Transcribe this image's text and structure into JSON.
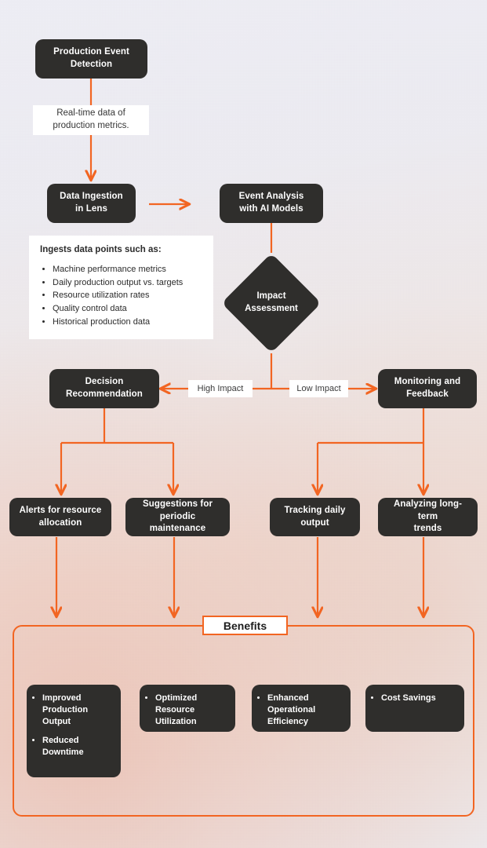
{
  "theme": {
    "node_bg": "#2f2e2c",
    "node_text": "#ffffff",
    "accent": "#f26522",
    "panel_bg": "#ffffff",
    "page_bg_top": "#eeeef5",
    "page_bg_bottom": "#f0e6e2"
  },
  "nodes": {
    "production_event_detection": "Production Event\nDetection",
    "data_ingestion": "Data Ingestion\nin Lens",
    "event_analysis": "Event Analysis\nwith AI Models",
    "impact_assessment": "Impact\nAssessment",
    "decision_recommendation": "Decision\nRecommendation",
    "monitoring_feedback": "Monitoring and\nFeedback",
    "alerts_resource": "Alerts for resource\nallocation",
    "suggestions_maintenance": "Suggestions for\nperiodic maintenance",
    "tracking_output": "Tracking daily\noutput",
    "analyzing_trends": "Analyzing long-term\ntrends"
  },
  "edge_labels": {
    "realtime_data": "Real-time data of\nproduction metrics.",
    "high_impact": "High Impact",
    "low_impact": "Low Impact"
  },
  "ingest_panel": {
    "title": "Ingests data points such as:",
    "items": [
      "Machine performance metrics",
      "Daily production output vs. targets",
      "Resource utilization rates",
      "Quality control data",
      "Historical production data"
    ]
  },
  "benefits": {
    "title": "Benefits",
    "cards": [
      {
        "items": [
          "Improved Production Output",
          "Reduced Downtime"
        ]
      },
      {
        "items": [
          "Optimized Resource Utilization"
        ]
      },
      {
        "items": [
          "Enhanced Operational Efficiency"
        ]
      },
      {
        "items": [
          "Cost Savings"
        ]
      }
    ]
  }
}
